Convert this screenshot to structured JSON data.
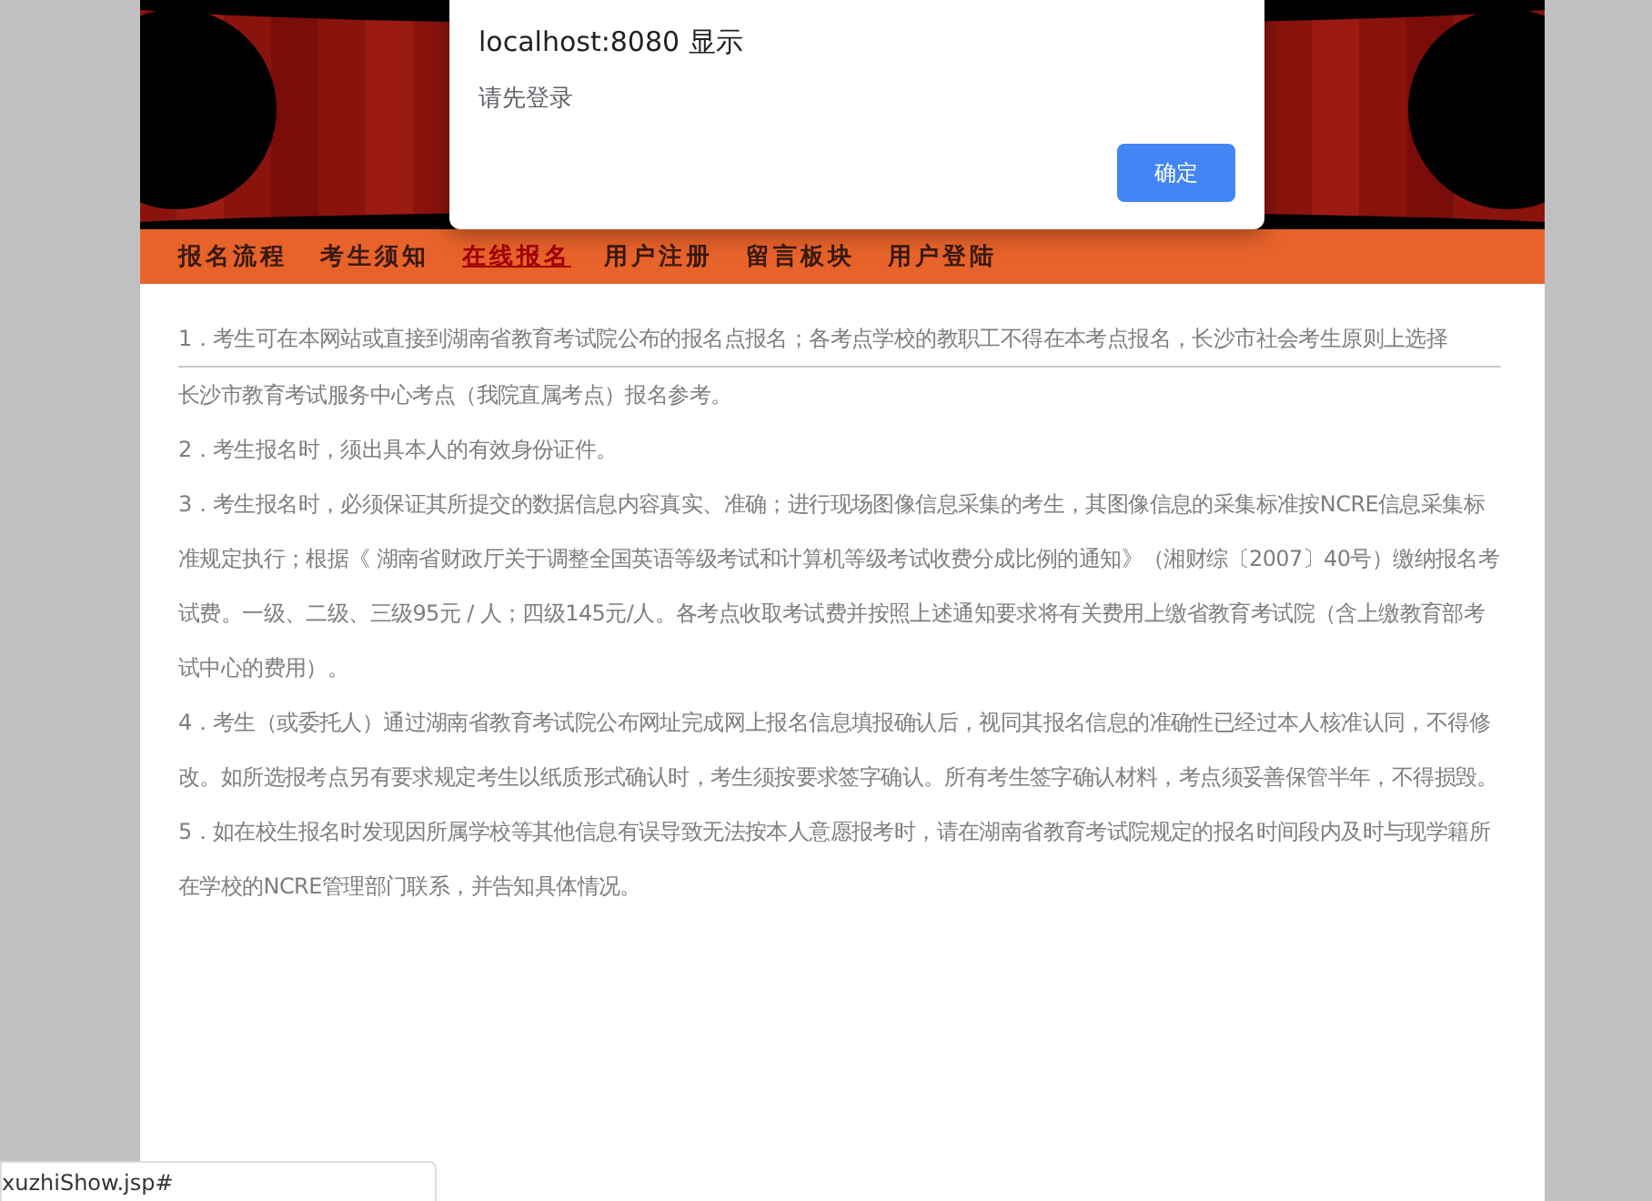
{
  "nav": [
    {
      "label": "报名流程",
      "selected": false
    },
    {
      "label": "考生须知",
      "selected": false
    },
    {
      "label": "在线报名",
      "selected": true
    },
    {
      "label": "用户注册",
      "selected": false
    },
    {
      "label": "留言板块",
      "selected": false
    },
    {
      "label": "用户登陆",
      "selected": false
    }
  ],
  "notice": [
    {
      "kind": "ruled",
      "text": "1．考生可在本网站或直接到湖南省教育考试院公布的报名点报名；各考点学校的教职工不得在本考点报名，长沙市社会考生原则上选择"
    },
    {
      "kind": "plain",
      "text": "长沙市教育考试服务中心考点（我院直属考点）报名参考。"
    },
    {
      "kind": "plain",
      "text": "2．考生报名时，须出具本人的有效身份证件。"
    },
    {
      "kind": "plain",
      "text": "3．考生报名时，必须保证其所提交的数据信息内容真实、准确；进行现场图像信息采集的考生，其图像信息的采集标准按NCRE信息采集标准规定执行；根据《 湖南省财政厅关于调整全国英语等级考试和计算机等级考试收费分成比例的通知》（湘财综〔2007〕40号）缴纳报名考试费。一级、二级、三级95元 / 人；四级145元/人。各考点收取考试费并按照上述通知要求将有关费用上缴省教育考试院（含上缴教育部考试中心的费用）。"
    },
    {
      "kind": "plain",
      "text": "4．考生（或委托人）通过湖南省教育考试院公布网址完成网上报名信息填报确认后，视同其报名信息的准确性已经过本人核准认同，不得修改。如所选报考点另有要求规定考生以纸质形式确认时，考生须按要求签字确认。所有考生签字确认材料，考点须妥善保管半年，不得损毁。"
    },
    {
      "kind": "plain",
      "text": "5．如在校生报名时发现因所属学校等其他信息有误导致无法按本人意愿报考时，请在湖南省教育考试院规定的报名时间段内及时与现学籍所在学校的NCRE管理部门联系，并告知具体情况。"
    }
  ],
  "dialog": {
    "title": "localhost:8080 显示",
    "message": "请先登录",
    "button": "确定"
  },
  "status_bar": {
    "url": "xuzhiShow.jsp#"
  }
}
